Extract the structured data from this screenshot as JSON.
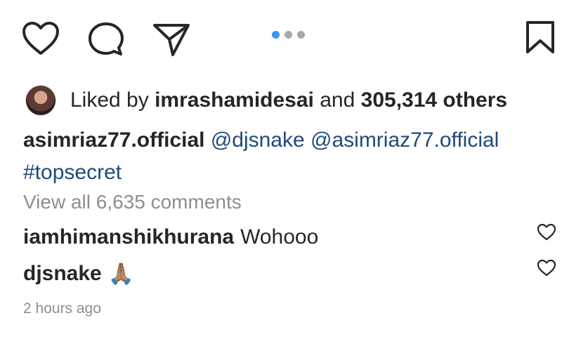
{
  "actions": {
    "like_icon": "heart-outline",
    "comment_icon": "speech-bubble",
    "share_icon": "paper-plane",
    "save_icon": "bookmark"
  },
  "carousel": {
    "total": 3,
    "active_index": 0,
    "active_color": "#3897f0",
    "inactive_color": "#a8a8a8"
  },
  "likes": {
    "prefix": "Liked by",
    "user": "imrashamidesai",
    "conjunction": "and",
    "count": "305,314 others"
  },
  "caption": {
    "username": "asimriaz77.official",
    "mention1": "@djsnake",
    "mention2": "@asimriaz77.official",
    "hashtag": "#topsecret"
  },
  "view_all": "View all 6,635 comments",
  "comments": [
    {
      "username": "iamhimanshikhurana",
      "text": "Wohooo"
    },
    {
      "username": "djsnake",
      "text": "🙏🏽"
    }
  ],
  "timestamp": "2 hours ago",
  "colors": {
    "text": "#262626",
    "secondary": "#8e8e8e",
    "link": "#1f4a7a"
  }
}
